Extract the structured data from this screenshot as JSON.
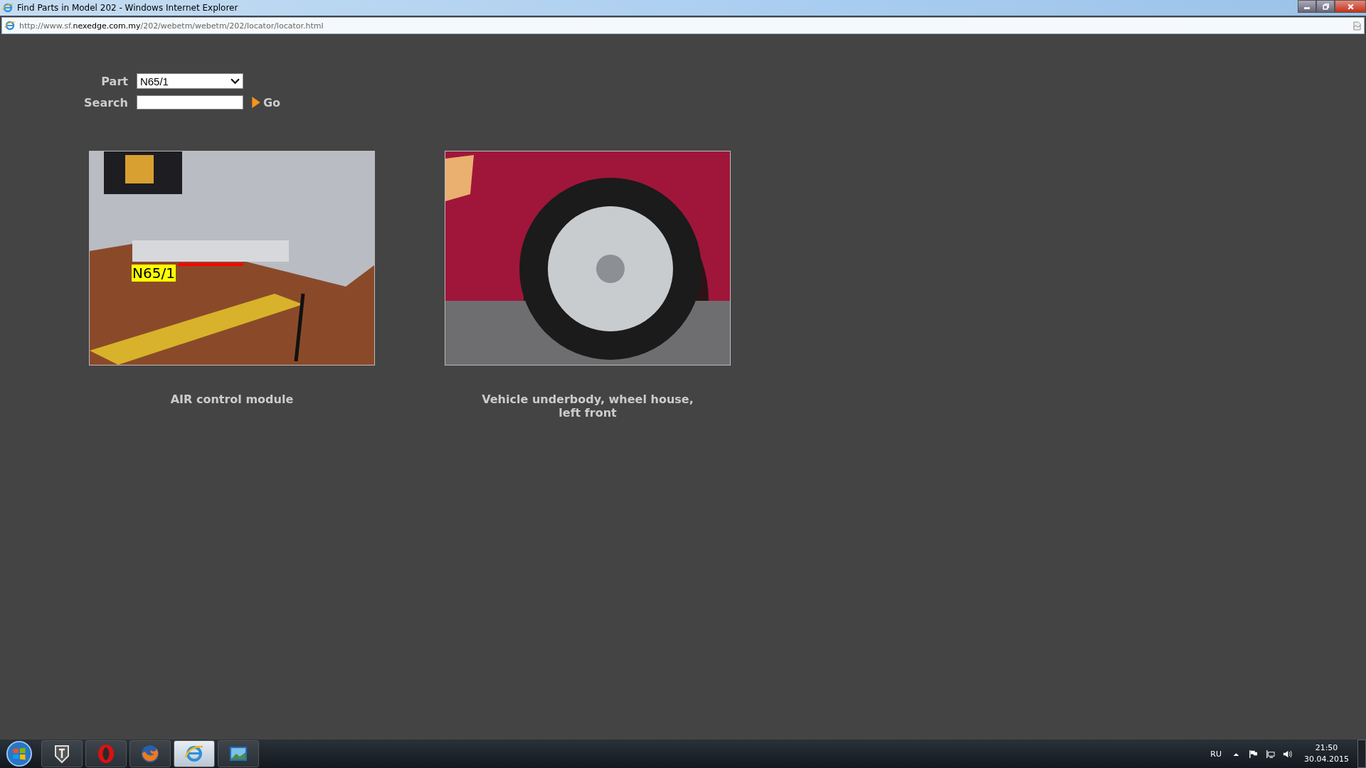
{
  "window": {
    "title": "Find Parts in Model 202 - Windows Internet Explorer"
  },
  "address_bar": {
    "url_prefix": "http://www.sf.",
    "url_domain": "nexedge.com.my",
    "url_path": "/202/webetm/webetm/202/locator/locator.html"
  },
  "form": {
    "part_label": "Part",
    "part_value": "N65/1",
    "search_label": "Search",
    "go_label": "Go"
  },
  "locations": [
    {
      "callout": "N65/1",
      "caption": "AIR control module",
      "kind": "underbody"
    },
    {
      "caption": "Vehicle underbody, wheel house, left front",
      "kind": "wheel"
    }
  ],
  "taskbar": {
    "apps": [
      {
        "kind": "tank",
        "selected": false
      },
      {
        "kind": "opera",
        "selected": false
      },
      {
        "kind": "firefox",
        "selected": false
      },
      {
        "kind": "ie",
        "selected": true
      },
      {
        "kind": "photo",
        "selected": false
      }
    ],
    "language": "RU",
    "time": "21:50",
    "date": "30.04.2015"
  }
}
